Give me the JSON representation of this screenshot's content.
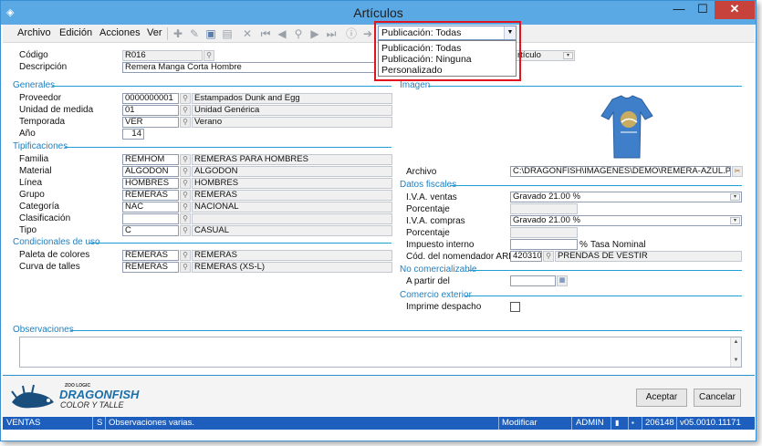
{
  "window": {
    "title": "Artículos"
  },
  "menu": {
    "archivo": "Archivo",
    "edicion": "Edición",
    "acciones": "Acciones",
    "ver": "Ver"
  },
  "popup": {
    "combo_value": "Publicación: Todas",
    "options": [
      "Publicación: Todas",
      "Publicación: Ninguna",
      "Personalizado"
    ]
  },
  "top_right": {
    "combo_value": "rtículo"
  },
  "header": {
    "codigo_label": "Código",
    "codigo_value": "R016",
    "descripcion_label": "Descripción",
    "descripcion_value": "Remera Manga Corta Hombre"
  },
  "generales": {
    "title": "Generales",
    "proveedor_label": "Proveedor",
    "proveedor_code": "0000000001",
    "proveedor_desc": "Estampados Dunk and Egg",
    "unidad_label": "Unidad de medida",
    "unidad_code": "01",
    "unidad_desc": "Unidad Genérica",
    "temporada_label": "Temporada",
    "temporada_code": "VER",
    "temporada_desc": "Verano",
    "anio_label": "Año",
    "anio_value": "14"
  },
  "tipificaciones": {
    "title": "Tipificaciones",
    "rows": [
      {
        "label": "Familia",
        "code": "REMHOM",
        "desc": "REMERAS PARA HOMBRES"
      },
      {
        "label": "Material",
        "code": "ALGODON",
        "desc": "ALGODÓN"
      },
      {
        "label": "Línea",
        "code": "HOMBRES",
        "desc": "HOMBRES"
      },
      {
        "label": "Grupo",
        "code": "REMERAS",
        "desc": "REMERAS"
      },
      {
        "label": "Categoría",
        "code": "NAC",
        "desc": "NACIONAL"
      },
      {
        "label": "Clasificación",
        "code": "",
        "desc": ""
      },
      {
        "label": "Tipo",
        "code": "C",
        "desc": "CASUAL"
      }
    ]
  },
  "condiciones": {
    "title": "Condicionales de uso",
    "rows": [
      {
        "label": "Paleta de colores",
        "code": "REMERAS",
        "desc": "REMERAS"
      },
      {
        "label": "Curva de talles",
        "code": "REMERAS",
        "desc": "REMERAS (XS-L)"
      }
    ]
  },
  "imagen": {
    "title": "Imagen",
    "archivo_label": "Archivo",
    "archivo_value": "C:\\DRAGONFISH\\IMAGENES\\DEMO\\REMERA-AZUL.PNG"
  },
  "fiscales": {
    "title": "Datos fiscales",
    "iva_ventas_label": "I.V.A. ventas",
    "iva_ventas_value": "Gravado 21.00 %",
    "porcentaje_label": "Porcentaje",
    "iva_compras_label": "I.V.A. compras",
    "iva_compras_value": "Gravado 21.00 %",
    "porcentaje2_label": "Porcentaje",
    "impuesto_label": "Impuesto interno",
    "impuesto_unit": "%",
    "tasa_label": "Tasa Nominal",
    "arba_label": "Cód. del nomendador ARBA",
    "arba_code": "420310",
    "arba_desc": "PRENDAS DE VESTIR"
  },
  "no_comercializable": {
    "title": "No comercializable",
    "apartir_label": "A partir del"
  },
  "comercio": {
    "title": "Comercio exterior",
    "imprime_label": "Imprime despacho"
  },
  "observaciones": {
    "title": "Observaciones"
  },
  "logo": {
    "top": "ZOO LOGIC",
    "brand": "DRAGONFISH",
    "sub": "COLOR Y TALLE"
  },
  "buttons": {
    "aceptar": "Aceptar",
    "cancelar": "Cancelar"
  },
  "status": {
    "module": "VENTAS",
    "flag": "S",
    "message": "Observaciones varias.",
    "mode": "Modificar",
    "user": "ADMIN",
    "num": "206148",
    "version": "v05.0010.11171"
  }
}
